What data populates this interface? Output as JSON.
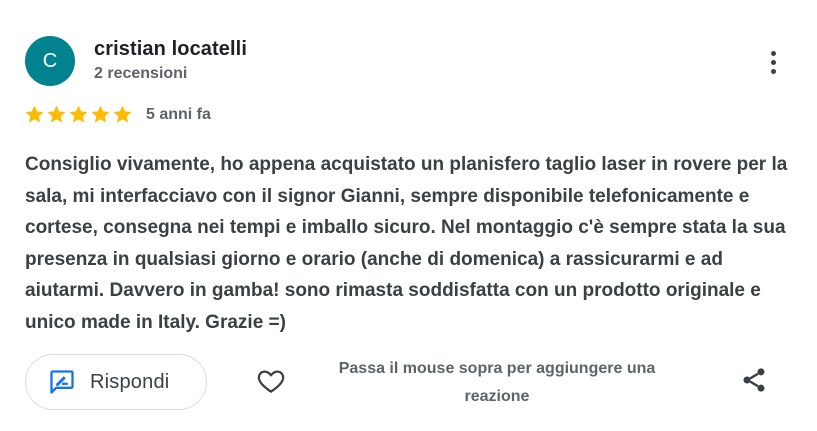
{
  "author": {
    "initial": "C",
    "name": "cristian locatelli",
    "meta": "2 recensioni",
    "avatar_color": "#00838f"
  },
  "menu": {
    "icon": "more-vert-icon"
  },
  "rating": {
    "stars": 5,
    "max_stars": 5,
    "star_color": "#fbbc04",
    "age": "5 anni fa"
  },
  "review": {
    "text": "Consiglio vivamente, ho appena acquistato un planisfero taglio laser in rovere per la sala, mi interfacciavo con il signor Gianni, sempre disponibile telefonicamente e cortese, consegna nei tempi e imballo sicuro. Nel montaggio c'è sempre stata la sua presenza in qualsiasi giorno e orario (anche di domenica) a rassicurarmi e ad aiutarmi. Davvero in gamba! sono rimasta soddisfatta con un prodotto originale e unico made in Italy. Grazie =)"
  },
  "actions": {
    "reply_label": "Rispondi",
    "reply_icon": "reply-comment-icon",
    "like_icon": "heart-icon",
    "reaction_hint": "Passa il mouse sopra per aggiungere una reazione",
    "share_icon": "share-icon",
    "accent": "#1a73e8"
  }
}
